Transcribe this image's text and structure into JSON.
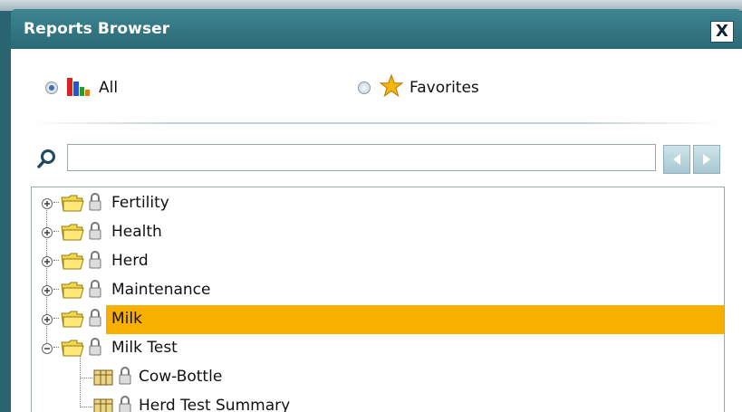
{
  "window": {
    "title": "Reports Browser",
    "close_label": "X"
  },
  "filter": {
    "all_label": "All",
    "favorites_label": "Favorites",
    "selected": "All"
  },
  "search": {
    "value": "",
    "placeholder": ""
  },
  "tree": {
    "folders": [
      {
        "label": "Fertility",
        "expanded": false
      },
      {
        "label": "Health",
        "expanded": false
      },
      {
        "label": "Herd",
        "expanded": false
      },
      {
        "label": "Maintenance",
        "expanded": false
      },
      {
        "label": "Milk",
        "expanded": false,
        "selected": true
      },
      {
        "label": "Milk Test",
        "expanded": true
      }
    ],
    "reports": [
      {
        "label": "Cow-Bottle"
      },
      {
        "label": "Herd Test Summary"
      }
    ]
  },
  "colors": {
    "titlebar": "#2c6e7a",
    "selection": "#f8b000",
    "folder": "#f3d64a"
  },
  "icons": [
    "close-icon",
    "bars-icon",
    "star-icon",
    "search-icon",
    "arrow-left-icon",
    "arrow-right-icon",
    "expand-icon",
    "collapse-icon",
    "folder-icon",
    "lock-icon",
    "report-icon"
  ]
}
